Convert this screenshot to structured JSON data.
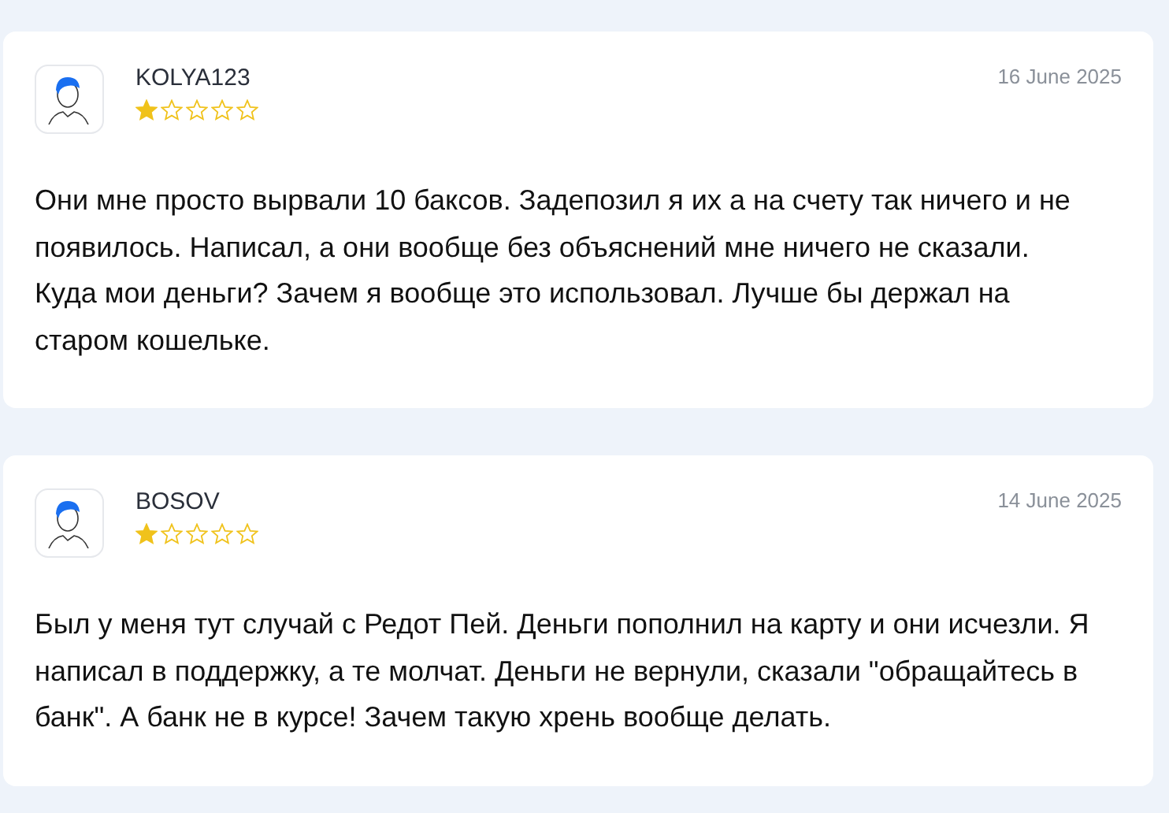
{
  "reviews": [
    {
      "author": "KOLYA123",
      "stars": 1,
      "date": "16 June 2025",
      "text": "Они мне просто вырвали 10 баксов. Задепозил я их а на счету так ничего и не появилось. Написал, а они вообще без объяснений мне ничего не сказали. Куда мои деньги? Зачем я вообще это использовал. Лучше бы держал на старом кошельке."
    },
    {
      "author": "BOSOV",
      "stars": 1,
      "date": "14 June 2025",
      "text": "Был у меня тут случай с Редот Пей. Деньги пополнил на карту и они исчезли. Я написал в поддержку, а те молчат. Деньги не вернули, сказали \"обращайтесь в банк\". А банк не в курсе! Зачем такую хрень вообще делать."
    }
  ]
}
